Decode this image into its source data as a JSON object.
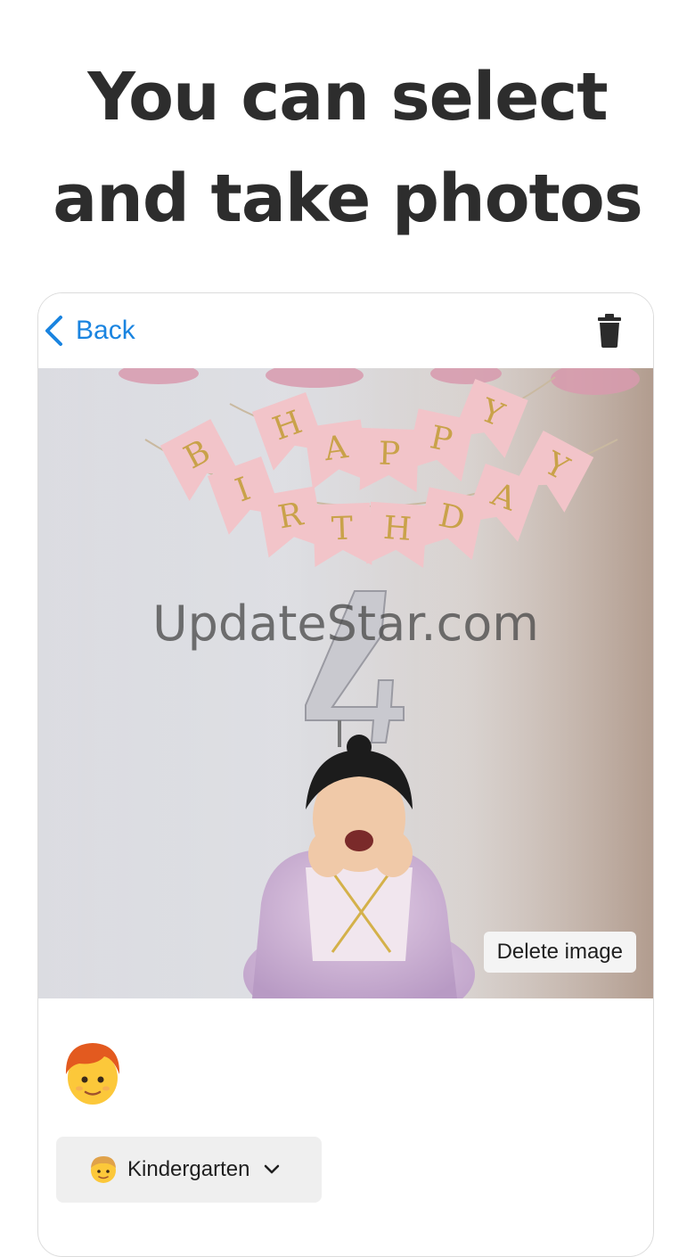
{
  "headline": {
    "line1": "You can select",
    "line2": "and take photos"
  },
  "navbar": {
    "back_label": "Back",
    "back_icon": "chevron-left-icon",
    "trash_icon": "trash-icon"
  },
  "photo": {
    "banner_letters_top": [
      "H",
      "A",
      "P",
      "P",
      "Y"
    ],
    "banner_letters_bottom": [
      "B",
      "I",
      "R",
      "T",
      "H",
      "D",
      "A",
      "Y"
    ],
    "watermark": "UpdateStar.com",
    "delete_button_label": "Delete image"
  },
  "profile": {
    "avatar_icon": "child-face-icon",
    "class_select": {
      "icon": "child-face-icon",
      "selected": "Kindergarten",
      "chevron_icon": "chevron-down-icon"
    }
  },
  "colors": {
    "accent": "#1a84e0",
    "headline": "#2d2d2d",
    "banner_pink": "#f2c4c9",
    "banner_gold": "#c9a24a"
  }
}
